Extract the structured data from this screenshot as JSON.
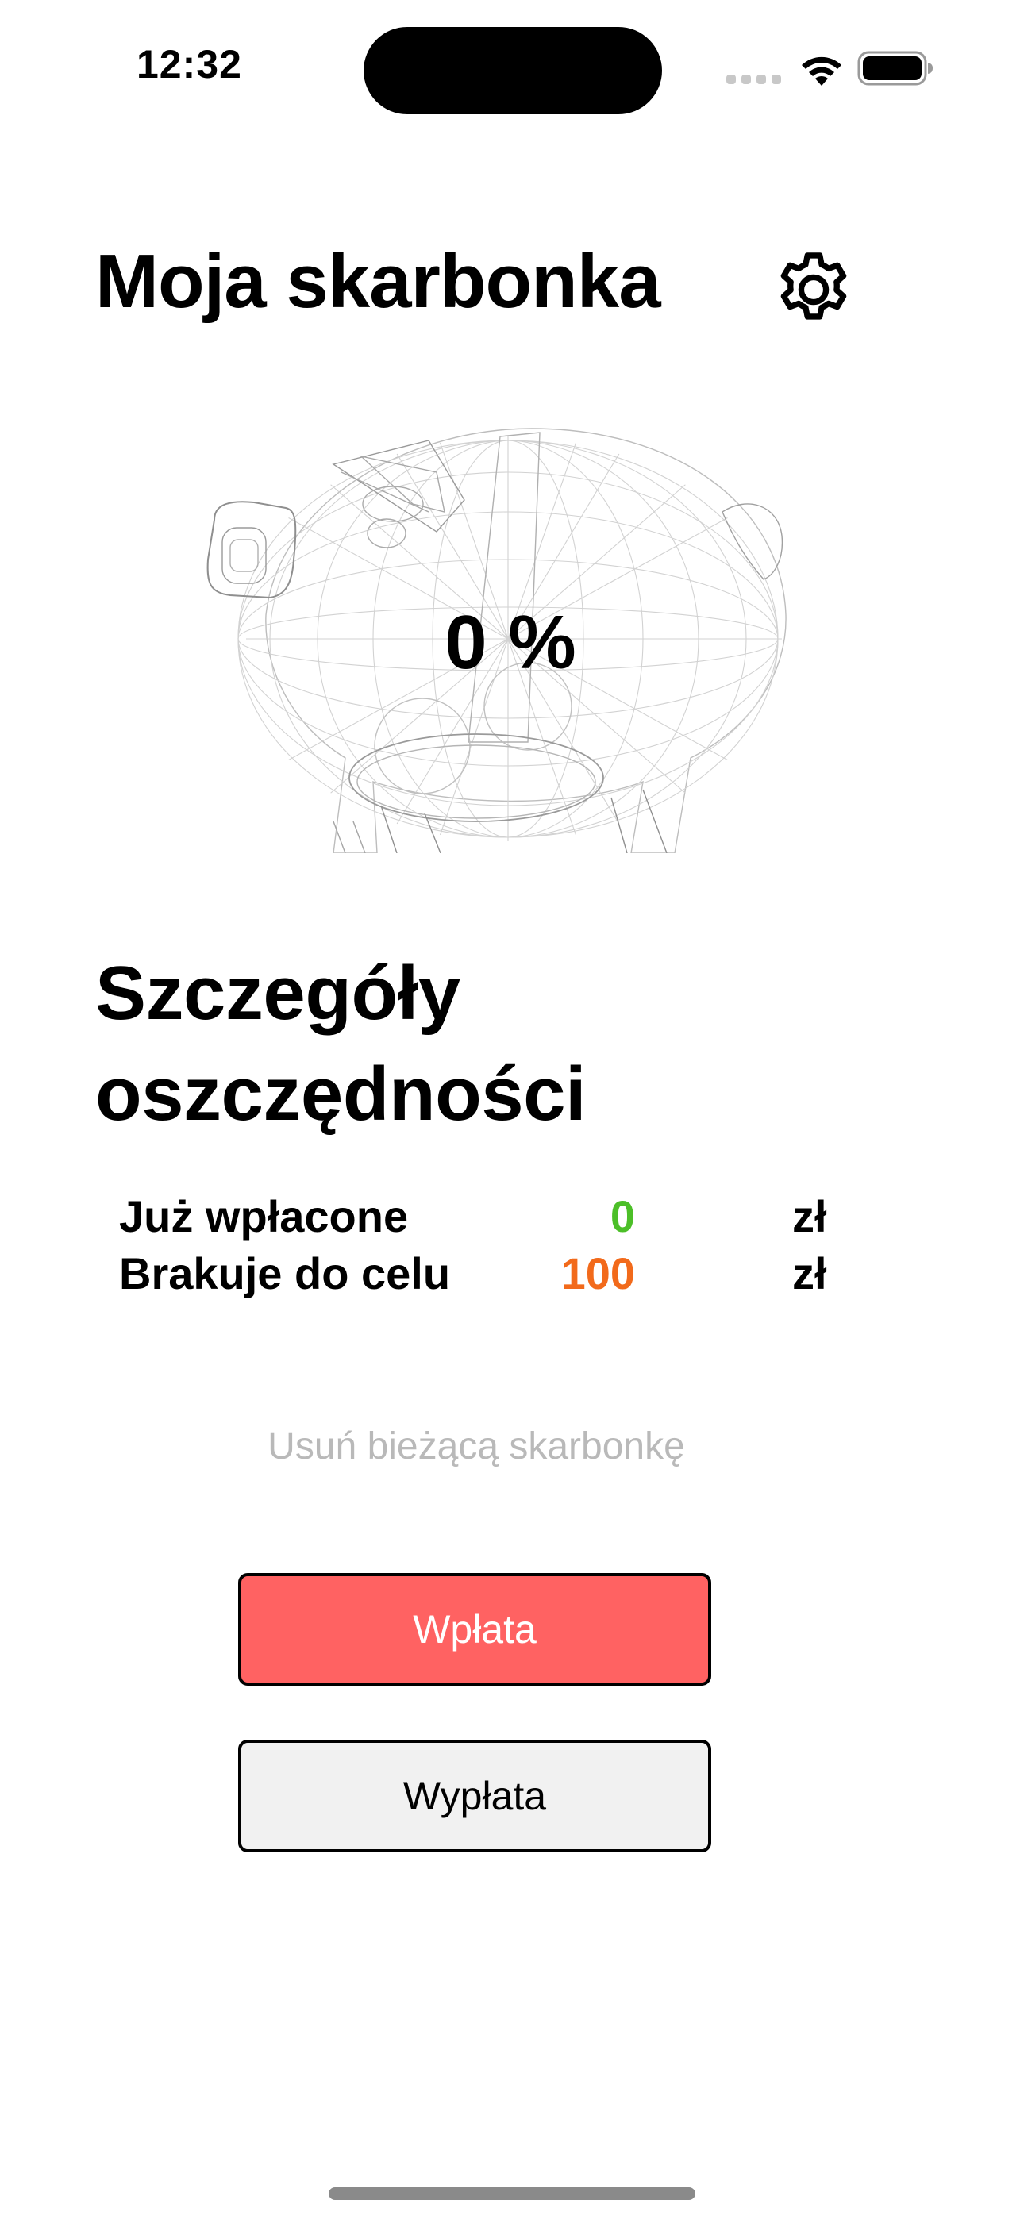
{
  "status_bar": {
    "time": "12:32"
  },
  "header": {
    "title": "Moja skarbonka",
    "settings_icon": "gear-icon"
  },
  "piggy": {
    "progress_text": "0 %",
    "progress_value": 0
  },
  "details": {
    "title": "Szczegóły oszczędności",
    "rows": [
      {
        "label": "Już wpłacone",
        "amount": "0",
        "currency": "zł",
        "color": "#4cbf28"
      },
      {
        "label": "Brakuje do celu",
        "amount": "100",
        "currency": "zł",
        "color": "#f26a1b"
      }
    ]
  },
  "actions": {
    "delete_label": "Usuń bieżącą skarbonkę",
    "deposit_label": "Wpłata",
    "withdraw_label": "Wypłata"
  },
  "colors": {
    "deposit_bg": "#ff6262",
    "withdraw_bg": "#f1f1f1",
    "muted_text": "#b9b9b9"
  }
}
